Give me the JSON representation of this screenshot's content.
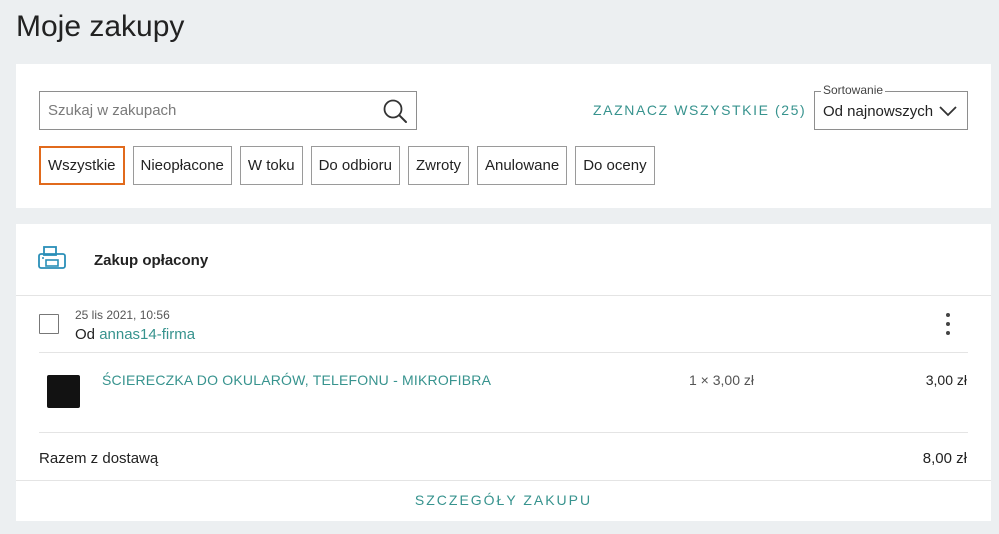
{
  "page": {
    "title": "Moje zakupy"
  },
  "search": {
    "placeholder": "Szukaj w zakupach",
    "value": ""
  },
  "toolbar": {
    "select_all_label": "ZAZNACZ WSZYSTKIE (25)"
  },
  "sort": {
    "legend": "Sortowanie",
    "selected": "Od najnowszych"
  },
  "filters": [
    {
      "label": "Wszystkie",
      "active": true
    },
    {
      "label": "Nieopłacone",
      "active": false
    },
    {
      "label": "W toku",
      "active": false
    },
    {
      "label": "Do odbioru",
      "active": false
    },
    {
      "label": "Zwroty",
      "active": false
    },
    {
      "label": "Anulowane",
      "active": false
    },
    {
      "label": "Do oceny",
      "active": false
    }
  ],
  "order": {
    "status": "Zakup opłacony",
    "date": "25 lis 2021, 10:56",
    "seller_prefix": "Od",
    "seller": "annas14-firma",
    "item": {
      "name": "ŚCIERECZKA DO OKULARÓW, TELEFONU - MIKROFIBRA",
      "quantity_price": "1 × 3,00 zł",
      "price": "3,00 zł"
    },
    "total_label": "Razem z dostawą",
    "total_value": "8,00 zł",
    "details_label": "SZCZEGÓŁY ZAKUPU"
  },
  "colors": {
    "accent": "#37938e",
    "active_chip": "#e16a1c",
    "background": "#eceff1"
  },
  "icons": {
    "search": "search-icon",
    "sort": "chevron-down-icon",
    "status": "printer-icon",
    "menu": "more-vertical-icon"
  }
}
